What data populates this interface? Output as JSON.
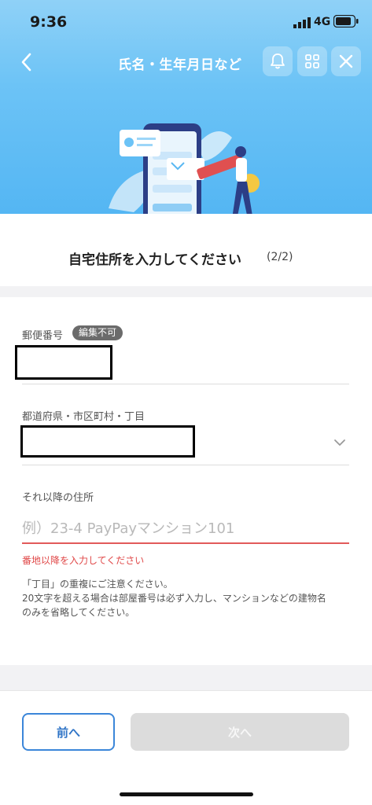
{
  "status_bar": {
    "time": "9:36",
    "network": "4G"
  },
  "nav": {
    "title": "氏名・生年月日など"
  },
  "page": {
    "subtitle": "自宅住所を入力してください",
    "step": "(2/2)"
  },
  "form": {
    "postal_label": "郵便番号",
    "postal_badge": "編集不可",
    "region_label": "都道府県・市区町村・丁目",
    "address_label": "それ以降の住所",
    "address_placeholder": "例）23-4 PayPayマンション101",
    "error_text": "番地以降を入力してください",
    "note_line1": "「丁目」の重複にご注意ください。",
    "note_line2": "20文字を超える場合は部屋番号は必ず入力し、マンションなどの建物名",
    "note_line3": "のみを省略してください。"
  },
  "footer": {
    "prev_label": "前へ",
    "next_label": "次へ"
  },
  "colors": {
    "header": "#6cc3f6",
    "error": "#e04848",
    "primary": "#2f74c6",
    "disabled": "#dcdcdc"
  }
}
